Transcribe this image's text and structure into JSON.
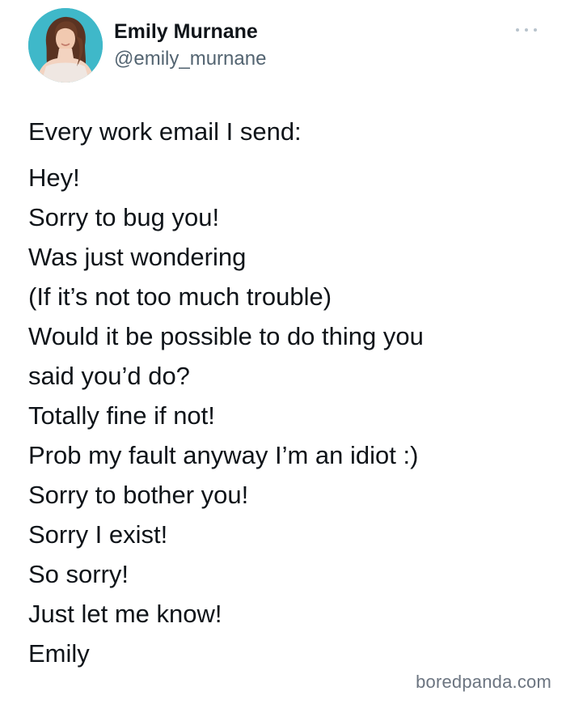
{
  "author": {
    "display_name": "Emily Murnane",
    "handle": "@emily_murnane"
  },
  "menu": {
    "icon": "more-horizontal-icon"
  },
  "tweet": {
    "intro": "Every work email I send:",
    "lines": [
      "Hey!",
      "Sorry to bug you!",
      "Was just wondering",
      "(If it’s not too much trouble)",
      "Would it be possible to do thing you",
      "said you’d do?",
      "Totally fine if not!",
      "Prob my fault anyway I’m an idiot :)",
      "Sorry to bother you!",
      "Sorry I exist!",
      "So sorry!",
      "Just let me know!",
      "Emily"
    ]
  },
  "watermark": "boredpanda.com",
  "colors": {
    "text": "#0f1419",
    "handle": "#536471",
    "avatar_bg": "#3fb8c9",
    "watermark": "#6b7480"
  }
}
